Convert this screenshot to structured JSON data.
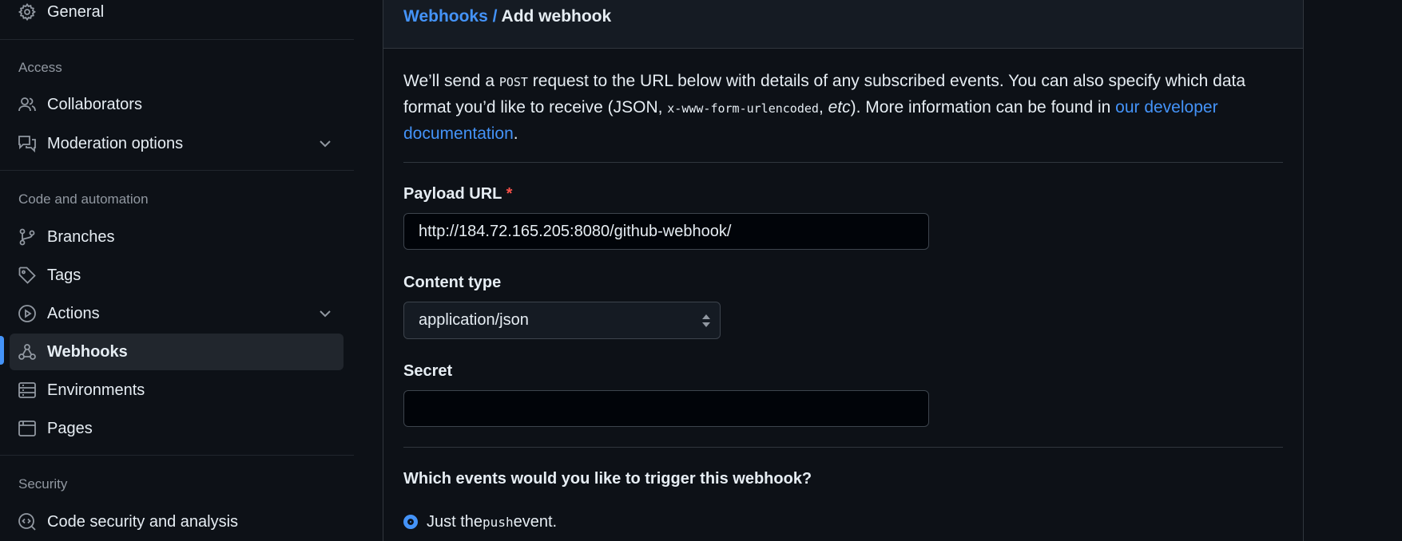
{
  "sidebar": {
    "general": "General",
    "access_title": "Access",
    "collaborators": "Collaborators",
    "moderation": "Moderation options",
    "code_title": "Code and automation",
    "branches": "Branches",
    "tags": "Tags",
    "actions": "Actions",
    "webhooks": "Webhooks",
    "environments": "Environments",
    "pages": "Pages",
    "security_title": "Security",
    "code_security": "Code security and analysis"
  },
  "breadcrumb": {
    "parent": "Webhooks",
    "separator": " / ",
    "current": "Add webhook"
  },
  "description": {
    "p1": "We’ll send a ",
    "code1": "POST",
    "p2": " request to the URL below with details of any subscribed events. You can also specify which data format you’d like to receive (JSON, ",
    "code2": "x-www-form-urlencoded",
    "p3": ", ",
    "em": "etc",
    "p4": "). More information can be found in ",
    "link": "our developer documentation",
    "p5": "."
  },
  "form": {
    "payload_label": "Payload URL",
    "required_mark": "*",
    "payload_value": "http://184.72.165.205:8080/github-webhook/",
    "content_type_label": "Content type",
    "content_type_value": "application/json",
    "secret_label": "Secret",
    "secret_value": ""
  },
  "events": {
    "question": "Which events would you like to trigger this webhook?",
    "just_the": "Just the ",
    "push_code": "push",
    "event": " event."
  },
  "colors": {
    "accent": "#4493f8",
    "required": "#f85149",
    "background": "#0d1117"
  }
}
